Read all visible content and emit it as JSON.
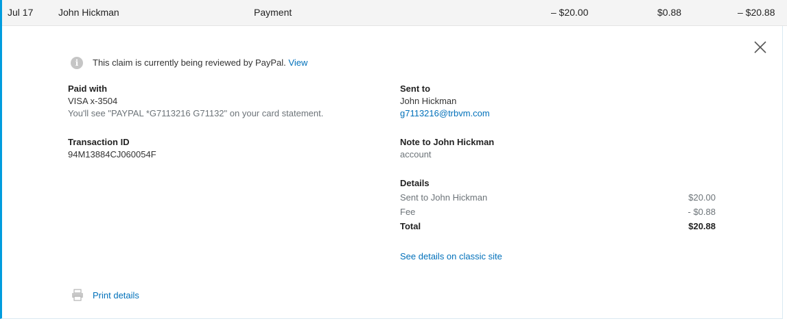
{
  "summary_row": {
    "date": "Jul 17",
    "name": "John Hickman",
    "type": "Payment",
    "gross": "– $20.00",
    "fee": "$0.88",
    "net": "– $20.88",
    "accent_color": "#009cde"
  },
  "claim_notice": {
    "text": "This claim is currently being reviewed by PayPal.",
    "link": "View",
    "icon": "info-icon"
  },
  "paid_with": {
    "label": "Paid with",
    "card": "VISA x-3504",
    "statement_note": "You'll see \"PAYPAL *G7113216 G71132\" on your card statement."
  },
  "transaction": {
    "label": "Transaction ID",
    "id": "94M13884CJ060054F"
  },
  "sent_to": {
    "label": "Sent to",
    "name": "John Hickman",
    "email": "g7113216@trbvm.com"
  },
  "note": {
    "label": "Note to John Hickman",
    "text": "account"
  },
  "details": {
    "label": "Details",
    "rows": [
      {
        "label": "Sent to John Hickman",
        "amount": "$20.00"
      },
      {
        "label": "Fee",
        "amount": "- $0.88"
      },
      {
        "label": "Total",
        "amount": "$20.88"
      }
    ]
  },
  "classic_link": "See details on classic site",
  "print": {
    "label": "Print details",
    "icon": "printer-icon"
  },
  "colors": {
    "link": "#0070ba",
    "accent": "#009cde",
    "muted": "#6c7378"
  }
}
